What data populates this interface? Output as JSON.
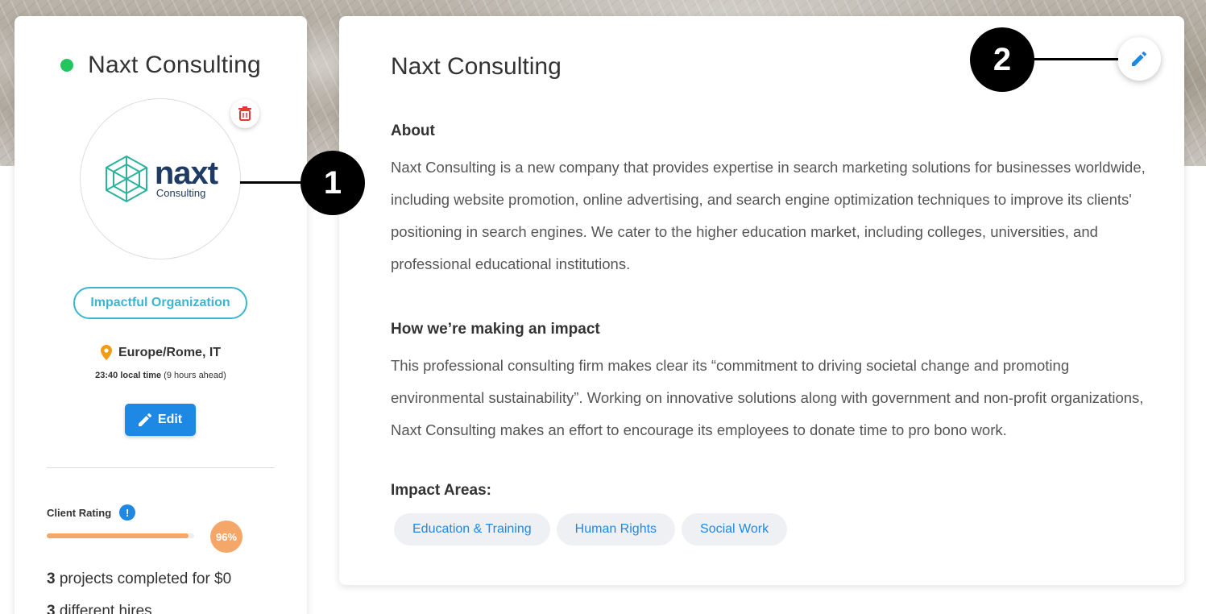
{
  "sidebar": {
    "org_name": "Naxt Consulting",
    "status_color": "#22c55e",
    "logo": {
      "big": "naxt",
      "small": "Consulting"
    },
    "badge": "Impactful Organization",
    "location": "Europe/Rome, IT",
    "local_time": "23:40 local time",
    "time_note": "(9 hours ahead)",
    "edit_label": "Edit",
    "rating": {
      "label": "Client Rating",
      "info": "!",
      "value": 0.96,
      "percent_text": "96%"
    },
    "stats": [
      {
        "num": "3",
        "text": "projects completed for $0"
      },
      {
        "num": "3",
        "text": "different hires"
      }
    ]
  },
  "main": {
    "title": "Naxt Consulting",
    "about_heading": "About",
    "about_text": "Naxt Consulting is a new company that provides expertise in search marketing solutions for businesses worldwide, including website promotion, online advertising, and search engine optimization techniques to improve its clients' positioning in search engines. We cater to the higher education market, including colleges, universities, and professional educational institutions.",
    "impact_heading": "How we’re making an impact",
    "impact_text": "This professional consulting firm makes clear its “commitment to driving societal change and promoting environmental sustainability”. Working on innovative solutions along with government and non-profit organizations, Naxt Consulting makes an effort to encourage its employees to donate time to pro bono work.",
    "areas_heading": "Impact Areas:",
    "areas": [
      "Education & Training",
      "Human Rights",
      "Social Work"
    ]
  },
  "callouts": [
    "1",
    "2"
  ],
  "colors": {
    "accent": "#1e88e5",
    "badge": "#3bb5d0",
    "rating": "#f5a769",
    "trash": "#e53935"
  }
}
